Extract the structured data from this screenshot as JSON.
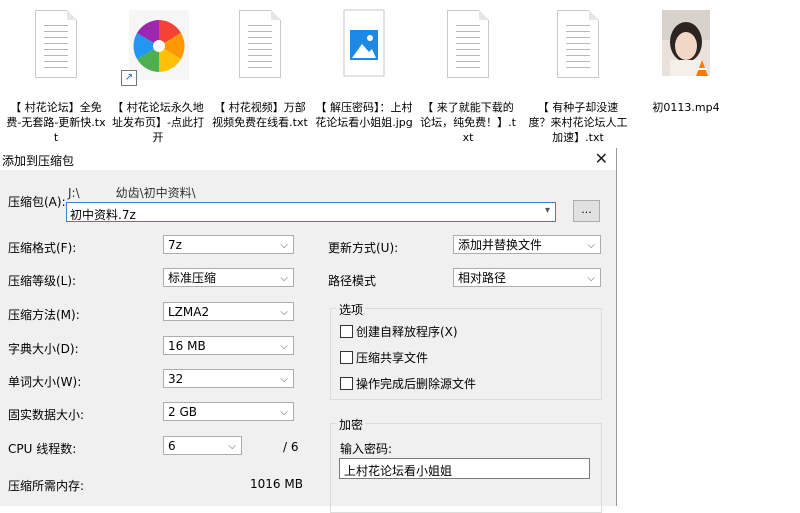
{
  "desktop": {
    "files": [
      {
        "name": "【 村花论坛】全免费-无套路-更新快.txt",
        "type": "txt"
      },
      {
        "name": "【 村花论坛永久地址发布页】-点此打开",
        "type": "shortcut"
      },
      {
        "name": "【 村花视频】万部视频免费在线看.txt",
        "type": "txt"
      },
      {
        "name": "【 解压密码】：上村花论坛看小姐姐.jpg",
        "type": "jpg"
      },
      {
        "name": "【 来了就能下载的论坛，纯免费！】.txt",
        "type": "txt"
      },
      {
        "name": "【 有种子却没速度？来村花论坛人工加速】.txt",
        "type": "txt"
      },
      {
        "name": "初0113.mp4",
        "type": "mp4"
      }
    ]
  },
  "dialog": {
    "title": "添加到压缩包",
    "archive": {
      "label": "压缩包(A):",
      "path": "J:\\　　　幼齿\\初中资料\\",
      "filename": "初中资料.7z",
      "browse": "..."
    },
    "left": {
      "format_label": "压缩格式(F):",
      "format_value": "7z",
      "level_label": "压缩等级(L):",
      "level_value": "标准压缩",
      "method_label": "压缩方法(M):",
      "method_value": "LZMA2",
      "dict_label": "字典大小(D):",
      "dict_value": "16 MB",
      "word_label": "单词大小(W):",
      "word_value": "32",
      "solid_label": "固实数据大小:",
      "solid_value": "2 GB",
      "threads_label": "CPU 线程数:",
      "threads_value": "6",
      "threads_max": "/ 6",
      "mem_label": "压缩所需内存:",
      "mem_value": "1016 MB"
    },
    "right": {
      "update_label": "更新方式(U):",
      "update_value": "添加并替换文件",
      "path_label": "路径模式",
      "path_value": "相对路径",
      "options_title": "选项",
      "opt_sfx": "创建自释放程序(X)",
      "opt_shared": "压缩共享文件",
      "opt_delete": "操作完成后删除源文件",
      "encrypt_title": "加密",
      "password_label": "输入密码:",
      "password_value": "上村花论坛看小姐姐"
    }
  }
}
